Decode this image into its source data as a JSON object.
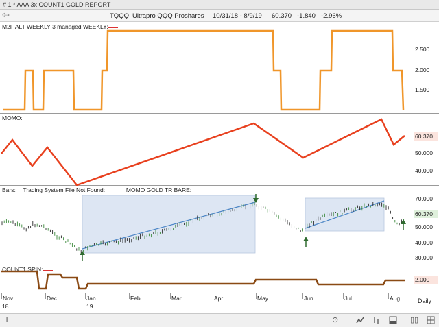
{
  "window": {
    "title": "# 1 * AAA 3x COUNT1 GOLD REPORT"
  },
  "symbol_bar": {
    "back_glyph": "⇦",
    "ticker": "TQQQ",
    "name": "Ultrapro QQQ Proshares",
    "date_range": "10/31/18 - 8/9/19",
    "last": "60.370",
    "change": "-1.840",
    "change_pct": "-2.96%"
  },
  "panels": {
    "m2f": {
      "label": "M2F ALT WEEKLY 3 managed WEEKLY:",
      "ticks": [
        "2.500",
        "2.000",
        "1.500"
      ]
    },
    "momo": {
      "label": "MOMO:",
      "ticks": [
        "50.000",
        "40.000"
      ],
      "last_value": "60.370"
    },
    "bars": {
      "label_bars": "Bars:",
      "label_trading": "Trading System File Not Found:",
      "label_gold": "MOMO GOLD TR BARE:",
      "ticks": [
        "70.000",
        "50.000",
        "40.000",
        "30.000"
      ],
      "last_value": "60.370"
    },
    "count1": {
      "label": "COUNT1 SPIN:",
      "last_value": "2.000"
    }
  },
  "x_axis": {
    "months": [
      "Nov",
      "Dec",
      "Jan",
      "Feb",
      "Mar",
      "Apr",
      "May",
      "Jun",
      "Jul",
      "Aug"
    ],
    "years": [
      "18",
      "19"
    ],
    "interval": "Daily"
  },
  "colors": {
    "m2f_line": "#f0962a",
    "momo_line": "#e8401e",
    "count1_line": "#8a4a14",
    "up_bar": "#3c8a3c",
    "down_bar": "#2a2a2a",
    "trend_line": "#4c86c6",
    "highlight_box": "#dde6f3",
    "arrow": "#2f6b2f"
  },
  "bottom_icons": [
    "plus-icon",
    "target-icon",
    "line-chart-icon",
    "bar-chart-icon",
    "panel-icon",
    "book-icon",
    "grid-icon"
  ]
}
